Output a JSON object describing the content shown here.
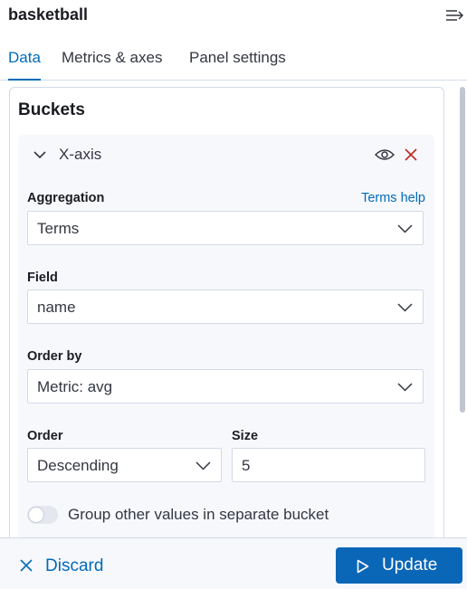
{
  "header": {
    "title": "basketball",
    "collapse_icon": "collapse-menu-icon"
  },
  "tabs": [
    {
      "label": "Data",
      "active": true
    },
    {
      "label": "Metrics & axes",
      "active": false
    },
    {
      "label": "Panel settings",
      "active": false
    }
  ],
  "buckets": {
    "title": "Buckets",
    "aggregation_item": {
      "name": "X-axis",
      "icons": [
        "chevron-down-icon",
        "eye-icon",
        "close-icon"
      ],
      "aggregation": {
        "label": "Aggregation",
        "help_link": "Terms help",
        "value": "Terms"
      },
      "field": {
        "label": "Field",
        "value": "name"
      },
      "order_by": {
        "label": "Order by",
        "value": "Metric: avg"
      },
      "order": {
        "label": "Order",
        "value": "Descending"
      },
      "size": {
        "label": "Size",
        "value": "5"
      },
      "group_other": {
        "label": "Group other values in separate bucket",
        "enabled": false
      }
    }
  },
  "footer": {
    "discard_label": "Discard",
    "update_label": "Update"
  },
  "colors": {
    "accent": "#006bb8",
    "primary_button": "#0a66b7",
    "danger": "#bd271e",
    "border": "#d3dae6",
    "panel_bg": "#f7f8fc"
  }
}
